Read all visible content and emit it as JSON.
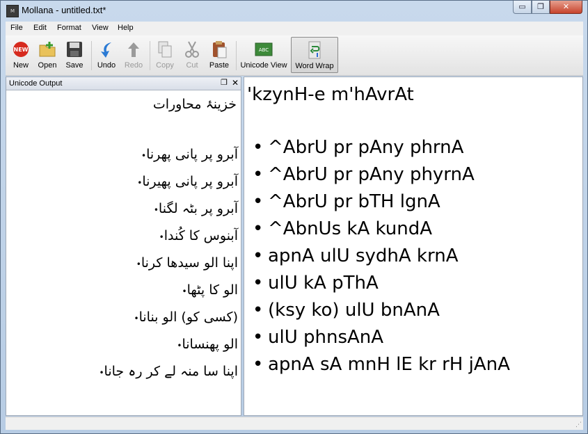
{
  "window": {
    "title": "Mollana - untitled.txt*",
    "min": "▭",
    "max": "❐",
    "close": "✕"
  },
  "menu": [
    "File",
    "Edit",
    "Format",
    "View",
    "Help"
  ],
  "toolbar": {
    "new": "New",
    "open": "Open",
    "save": "Save",
    "undo": "Undo",
    "redo": "Redo",
    "copy": "Copy",
    "cut": "Cut",
    "paste": "Paste",
    "unicode_view": "Unicode View",
    "word_wrap": "Word Wrap",
    "new_badge": "NEW",
    "abc_badge": "ABC"
  },
  "panel": {
    "title": "Unicode Output",
    "urdu_title": "خزینۂ محاورات",
    "bullet": "•",
    "lines": [
      "آبرو پر پانی پھرنا",
      "آبرو پر پانی پھیرنا",
      "آبرو پر بٹہ لگنا",
      "آبنوس کا کُندا",
      "اپنا الو سیدھا کرنا",
      "الو کا پٹھا",
      "(کسی کو) الو بنانا",
      "الو پھنسانا",
      "اپنا سا منہ لے کر رہ جانا"
    ]
  },
  "editor": {
    "title": "'kzynH-e m'hAvrAt",
    "bullet": "•",
    "lines": [
      "^AbrU pr pAny phrnA",
      "^AbrU pr pAny phyrnA",
      "^AbrU pr bTH lgnA",
      "^AbnUs kA kundA",
      "apnA ulU sydhA krnA",
      "ulU kA pThA",
      "(ksy ko) ulU bnAnA",
      "ulU phnsAnA",
      "apnA sA mnH lE kr rH jAnA"
    ]
  }
}
